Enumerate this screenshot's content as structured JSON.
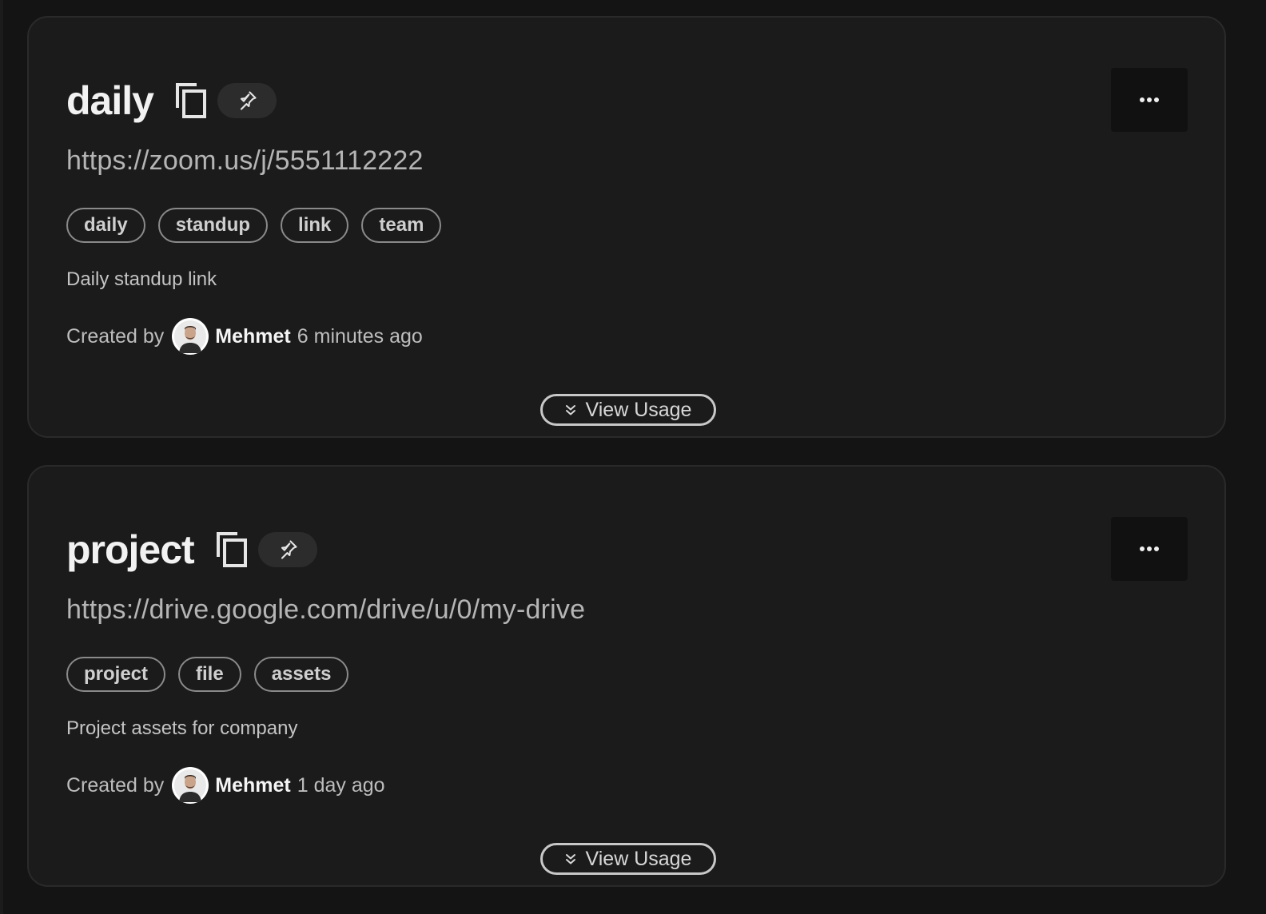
{
  "links": [
    {
      "title": "daily",
      "url": "https://zoom.us/j/5551112222",
      "tags": [
        "daily",
        "standup",
        "link",
        "team"
      ],
      "description": "Daily standup link",
      "created_by_label": "Created by",
      "author": "Mehmet",
      "time_ago": "6 minutes ago",
      "view_usage_label": "View Usage"
    },
    {
      "title": "project",
      "url": "https://drive.google.com/drive/u/0/my-drive",
      "tags": [
        "project",
        "file",
        "assets"
      ],
      "description": "Project assets for company",
      "created_by_label": "Created by",
      "author": "Mehmet",
      "time_ago": "1 day ago",
      "view_usage_label": "View Usage"
    }
  ],
  "icons": {
    "copy": "copy-icon",
    "pin": "pin-icon",
    "more": "more-icon",
    "expand": "chevrons-down-icon"
  },
  "colors": {
    "background": "#141414",
    "card": "#1b1b1b",
    "card_border": "#2a2a2a",
    "pin_button": "#2c2c2c",
    "more_button": "#111111"
  }
}
